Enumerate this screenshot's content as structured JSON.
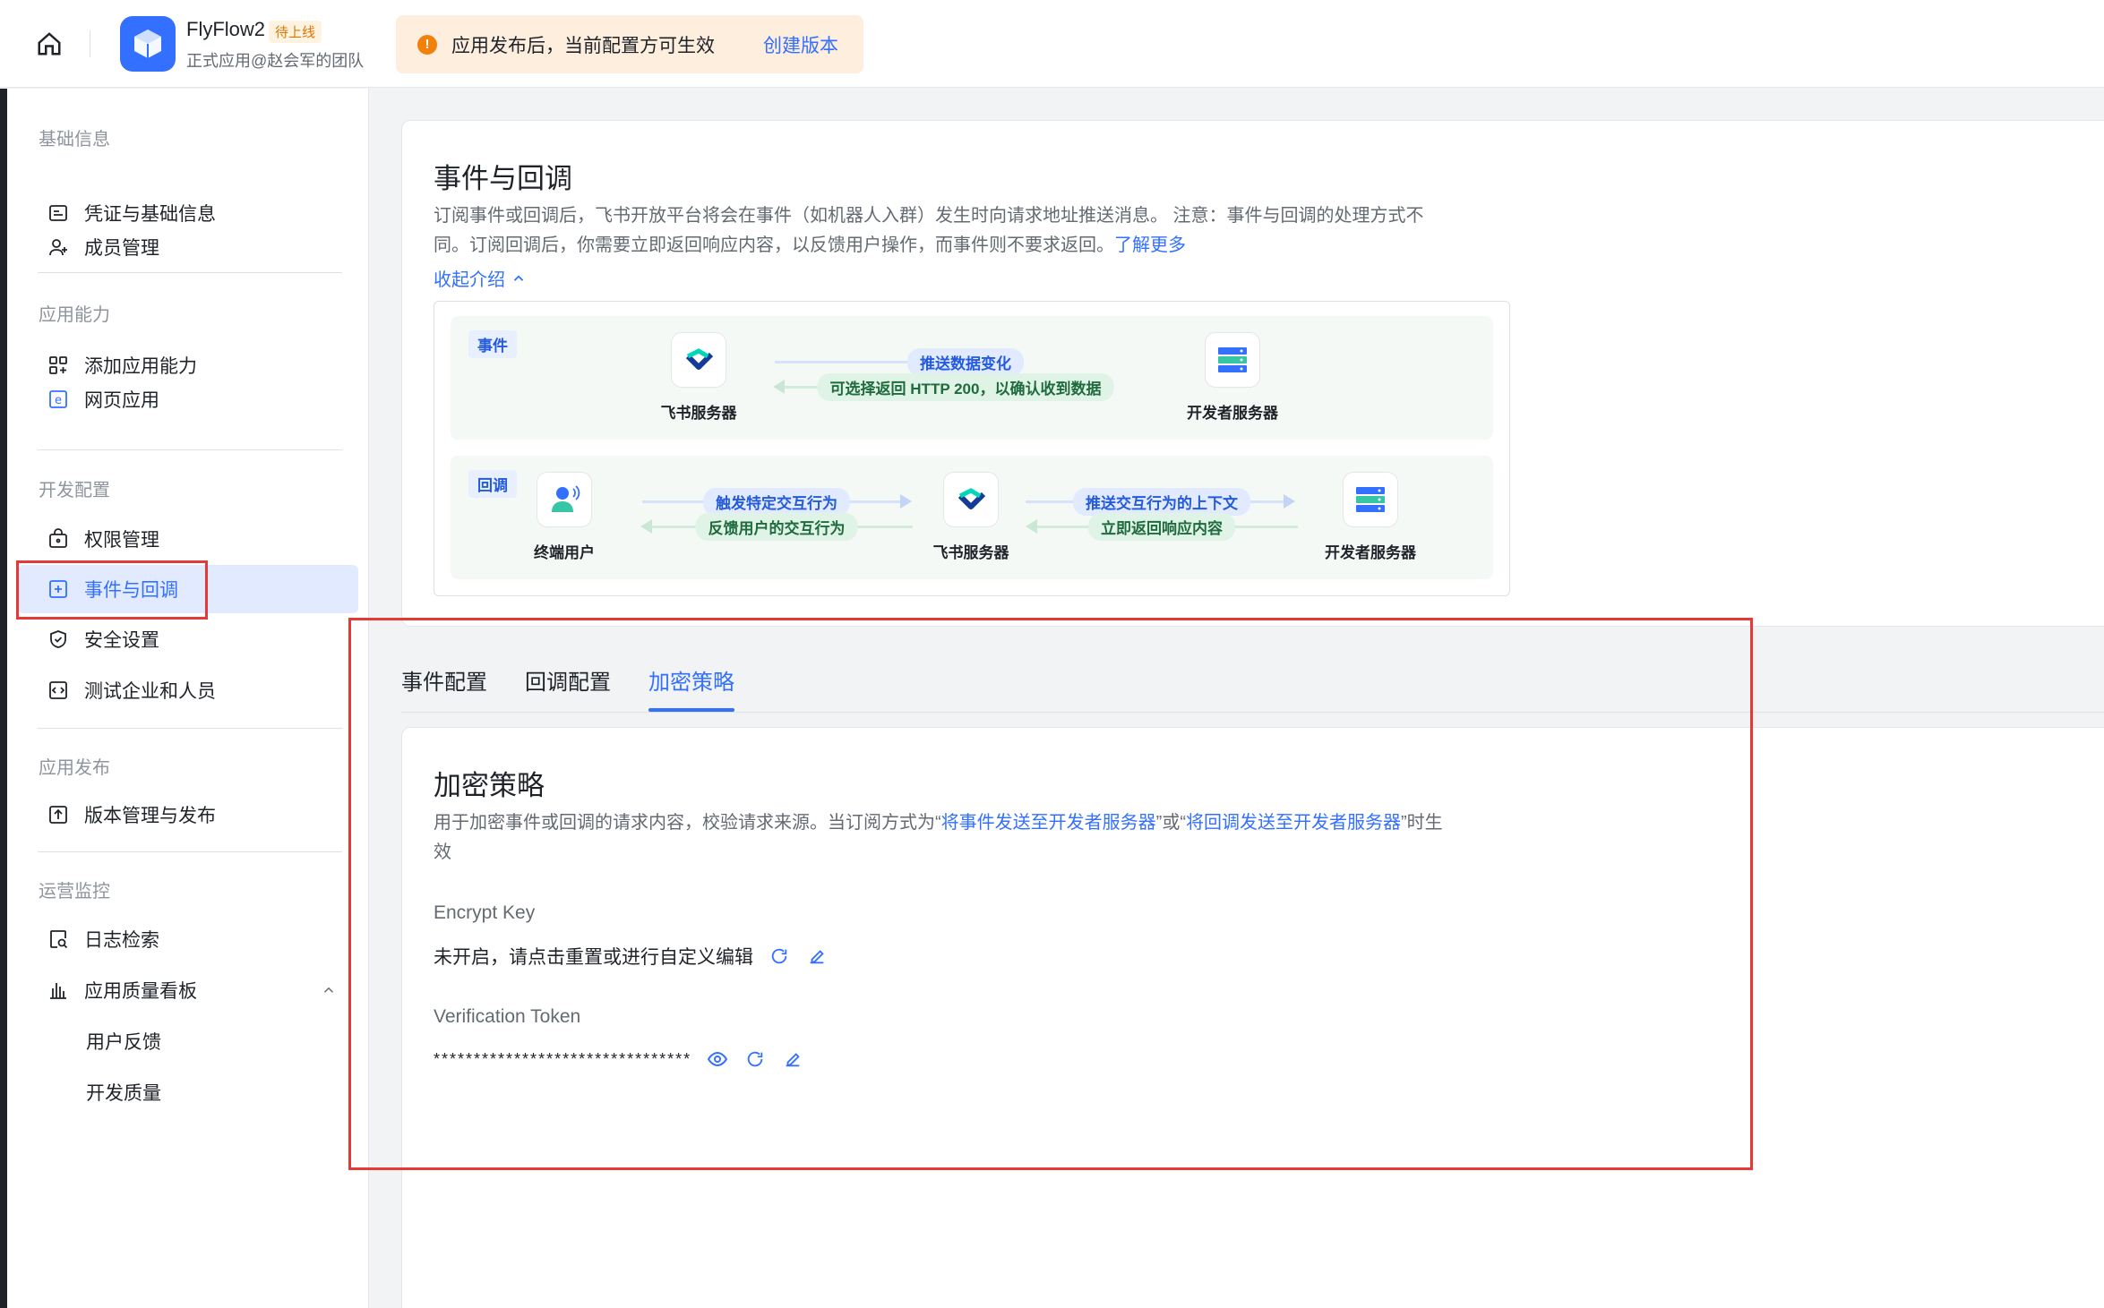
{
  "header": {
    "app_name": "FlyFlow2",
    "app_status": "待上线",
    "app_subtitle": "正式应用@赵会军的团队",
    "notice_text": "应用发布后，当前配置方可生效",
    "notice_link": "创建版本",
    "notice_icon": "!"
  },
  "sidebar": {
    "sections": {
      "basic": "基础信息",
      "capability": "应用能力",
      "dev": "开发配置",
      "release": "应用发布",
      "ops": "运营监控"
    },
    "items": {
      "credentials": "凭证与基础信息",
      "members": "成员管理",
      "add_capability": "添加应用能力",
      "web_app": "网页应用",
      "permissions": "权限管理",
      "events": "事件与回调",
      "security": "安全设置",
      "test_tenant": "测试企业和人员",
      "versions": "版本管理与发布",
      "logs": "日志检索",
      "quality": "应用质量看板",
      "feedback": "用户反馈",
      "dev_quality": "开发质量"
    }
  },
  "intro": {
    "title": "事件与回调",
    "desc_line1": "订阅事件或回调后，飞书开放平台将会在事件（如机器人入群）发生时向请求地址推送消息。 注意：事件与回调的处理方式不",
    "desc_line2": "同。订阅回调后，你需要立即返回响应内容，以反馈用户操作，而事件则不要求返回。",
    "learn_more": "了解更多",
    "collapse": "收起介绍"
  },
  "diagram": {
    "event_tag": "事件",
    "callback_tag": "回调",
    "feishu_server": "飞书服务器",
    "dev_server": "开发者服务器",
    "end_user": "终端用户",
    "push_data": "推送数据变化",
    "optional_return": "可选择返回 HTTP 200，以确认收到数据",
    "trigger_action": "触发特定交互行为",
    "feedback_action": "反馈用户的交互行为",
    "push_context": "推送交互行为的上下文",
    "return_response": "立即返回响应内容"
  },
  "tabs": [
    "事件配置",
    "回调配置",
    "加密策略"
  ],
  "encryption": {
    "title": "加密策略",
    "desc_prefix": "用于加密事件或回调的请求内容，校验请求来源。当订阅方式为“",
    "desc_link1": "将事件发送至开发者服务器",
    "desc_mid": "”或“",
    "desc_link2": "将回调发送至开发者服务器",
    "desc_suffix": "”时生",
    "desc_line2": "效",
    "encrypt_key_label": "Encrypt Key",
    "encrypt_key_value": "未开启，请点击重置或进行自定义编辑",
    "token_label": "Verification Token",
    "token_value": "********************************"
  },
  "colors": {
    "accent": "#3370ff",
    "highlight": "#e53935",
    "notice_bg": "#fdeedd"
  }
}
